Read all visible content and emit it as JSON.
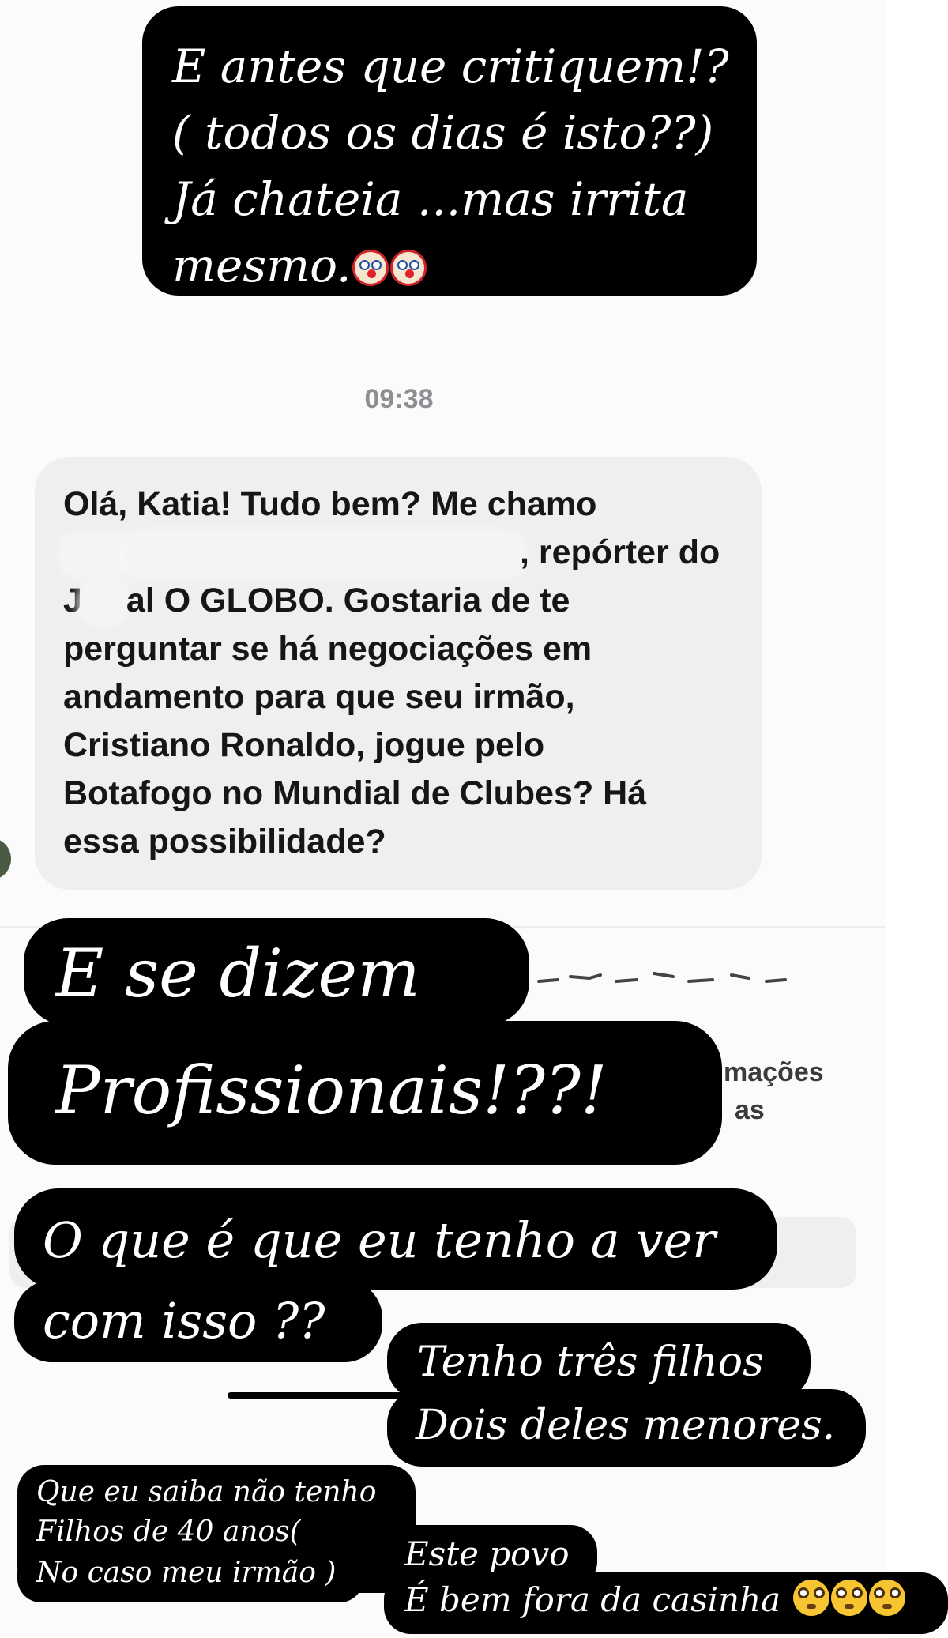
{
  "overlay_notes": {
    "note_1": {
      "lines": [
        "E antes que critiquem!?",
        "( todos os dias é isto??)",
        "Já chateia ...mas irrita",
        "mesmo."
      ],
      "emoji": [
        "clown-face-icon",
        "clown-face-icon"
      ]
    },
    "note_2": {
      "lines": [
        "E se dizem",
        "Profissionais!??!"
      ]
    },
    "note_3": {
      "lines": [
        "O que é que eu tenho a ver",
        "com isso ??"
      ]
    },
    "note_4": {
      "lines": [
        "Tenho três filhos",
        "Dois deles menores."
      ]
    },
    "note_5": {
      "lines": [
        "Que eu saiba não tenho",
        "Filhos de 40 anos(",
        "No caso meu irmão )"
      ]
    },
    "note_6": {
      "lines": [
        "Este povo",
        "É bem fora da casinha"
      ],
      "emoji": [
        "flushed-face-icon",
        "flushed-face-icon",
        "flushed-face-icon"
      ]
    }
  },
  "chat": {
    "timestamp": "09:38",
    "message": {
      "line_1": "Olá, Katia! Tudo bem? Me chamo",
      "line_2_visible": ", repórter do",
      "line_3_prefix": "J",
      "line_3_rest": "al O GLOBO. Gostaria de te",
      "line_4": "perguntar se há negociações em",
      "line_5": "andamento para que seu irmão,",
      "line_6": "Cristiano Ronaldo, jogue pelo",
      "line_7": "Botafogo no Mundial de Clubes? Há",
      "line_8": "essa possibilidade?"
    },
    "partial_texts": [
      "mações",
      "as"
    ]
  },
  "colors": {
    "note_background": "#000000",
    "note_text": "#ffffff",
    "bubble_background": "#efefef",
    "timestamp": "#8e8e93"
  }
}
